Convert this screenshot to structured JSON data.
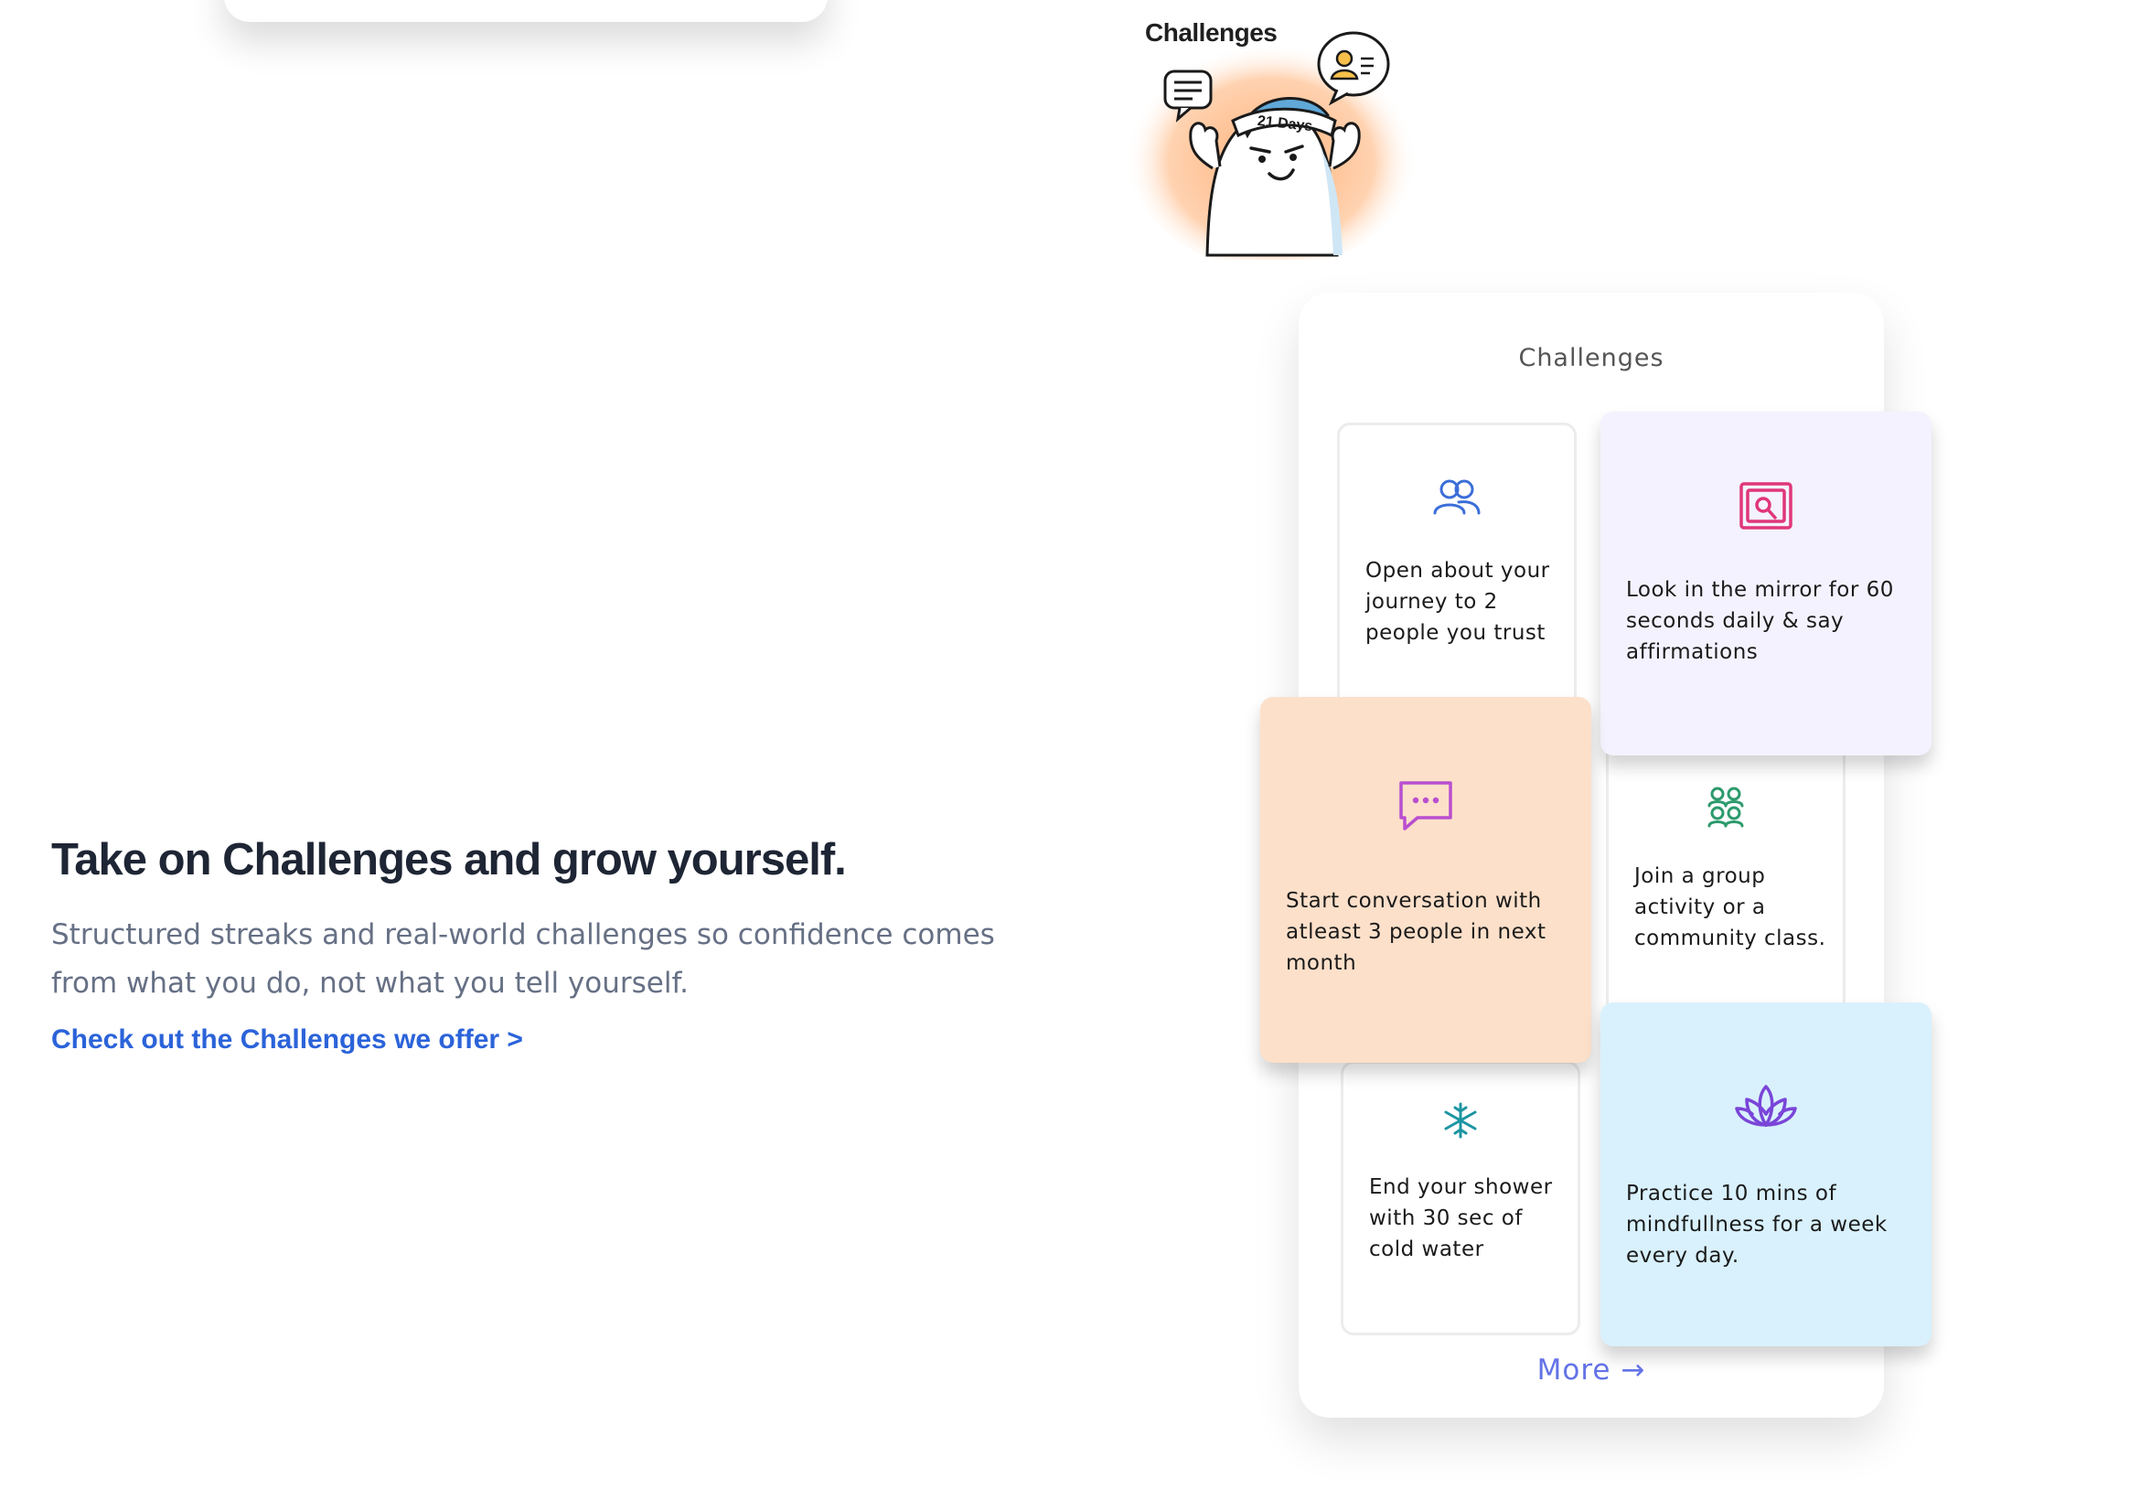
{
  "hero": {
    "title": "Challenges",
    "badge": "21 Days"
  },
  "intro": {
    "headline": "Take on Challenges and grow yourself.",
    "description": "Structured streaks and real-world challenges so confidence comes from what you do, not what you tell yourself.",
    "cta": "Check out the Challenges we offer >"
  },
  "panel": {
    "title": "Challenges",
    "more": "More →",
    "cards": [
      {
        "text": "Open about your journey to 2 people you trust",
        "icon": "people-icon",
        "bg": "#ffffff"
      },
      {
        "text": "Look in the mirror for 60 seconds daily & say affirmations",
        "icon": "mirror-icon",
        "bg": "#f4f2fe"
      },
      {
        "text": "Start conversation with atleast 3 people in next month",
        "icon": "chat-icon",
        "bg": "#fde0ca"
      },
      {
        "text": "Join a group activity or a community class.",
        "icon": "group-icon",
        "bg": "#ffffff"
      },
      {
        "text": "End your shower with 30 sec of cold water",
        "icon": "snowflake-icon",
        "bg": "#ffffff"
      },
      {
        "text": "Practice 10 mins of mindfullness for a week every day.",
        "icon": "lotus-icon",
        "bg": "#d9f1fd"
      }
    ]
  },
  "colors": {
    "cta": "#2b63d9",
    "more": "#6373e6",
    "people_icon": "#3b6ed8",
    "mirror_icon": "#e0367a",
    "chat_icon": "#b94fd0",
    "group_icon": "#2c9a6c",
    "snowflake_icon": "#1c95a3",
    "lotus_icon": "#7a45d8"
  }
}
